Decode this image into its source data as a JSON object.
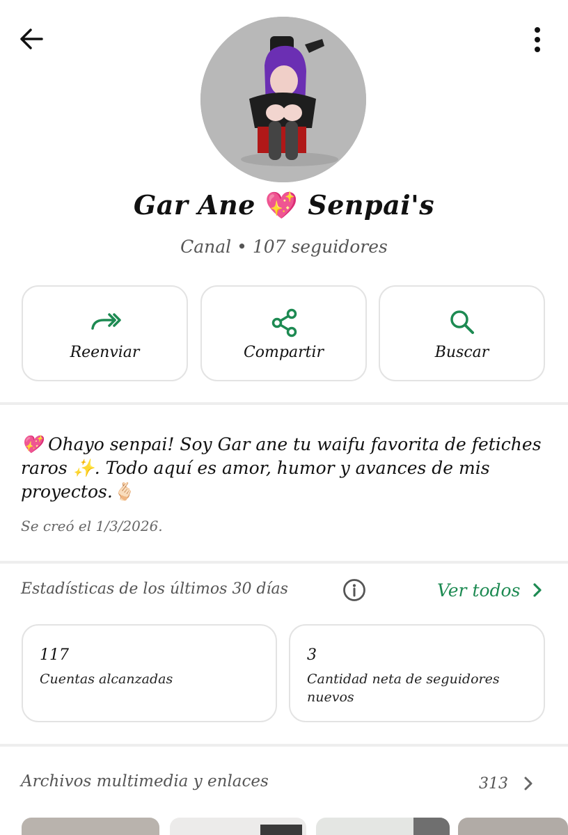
{
  "header": {
    "back_icon": "arrow-left-icon",
    "menu_icon": "more-vertical-icon"
  },
  "channel": {
    "name_part1": "Gar Ane",
    "name_emoji": "💖",
    "name_part2": "Senpai's",
    "meta": "Canal • 107 seguidores"
  },
  "actions": [
    {
      "label": "Reenviar",
      "icon": "forward-icon"
    },
    {
      "label": "Compartir",
      "icon": "share-icon"
    },
    {
      "label": "Buscar",
      "icon": "search-icon"
    }
  ],
  "description": {
    "text": "💖 Ohayo senpai! Soy Gar ane tu waifu favorita de fetiches raros ✨. Todo aquí es amor, humor y avances de mis proyectos.🫰🏻",
    "created": "Se creó el 1/3/2026."
  },
  "stats": {
    "title": "Estadísticas de los últimos 30 días",
    "see_all": "Ver todos",
    "cards": [
      {
        "value": "117",
        "label": "Cuentas alcanzadas"
      },
      {
        "value": "3",
        "label": "Cantidad neta de seguidores nuevos"
      }
    ]
  },
  "media": {
    "title": "Archivos multimedia y enlaces",
    "count": "313"
  },
  "colors": {
    "accent": "#1d8a52",
    "border": "#e3e3e3",
    "divider": "#eeeeee",
    "muted_text": "#555555"
  }
}
